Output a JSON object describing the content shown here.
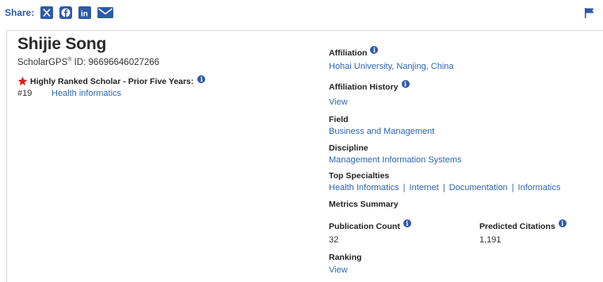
{
  "share": {
    "label": "Share:",
    "icons": [
      "x-twitter-icon",
      "facebook-icon",
      "linkedin-icon",
      "email-icon"
    ]
  },
  "flag_icon": "flag-icon",
  "profile": {
    "name": "Shijie Song",
    "gps_brand": "ScholarGPS",
    "gps_reg": "®",
    "gps_id": " ID: 96696646027266",
    "ranked_label": "Highly Ranked Scholar - Prior Five Years:",
    "rank_number": "#19",
    "rank_field": "Health informatics"
  },
  "details": {
    "affiliation_label": "Affiliation",
    "affiliation_value": "Hohai University, Nanjing, China",
    "affiliation_history_label": "Affiliation History",
    "affiliation_history_link": "View",
    "field_label": "Field",
    "field_value": "Business and Management",
    "discipline_label": "Discipline",
    "discipline_value": "Management Information Systems",
    "top_specialties_label": "Top Specialties",
    "top_specialties": [
      "Health Informatics",
      "Internet",
      "Documentation",
      "Informatics"
    ],
    "metrics_summary_label": "Metrics Summary",
    "publication_count_label": "Publication Count",
    "publication_count_value": "32",
    "predicted_citations_label": "Predicted Citations",
    "predicted_citations_value": "1,191",
    "ranking_label": "Ranking",
    "ranking_link": "View"
  },
  "colors": {
    "accent": "#2e5aa8",
    "link": "#2f67b4",
    "star": "#e01b1b"
  }
}
